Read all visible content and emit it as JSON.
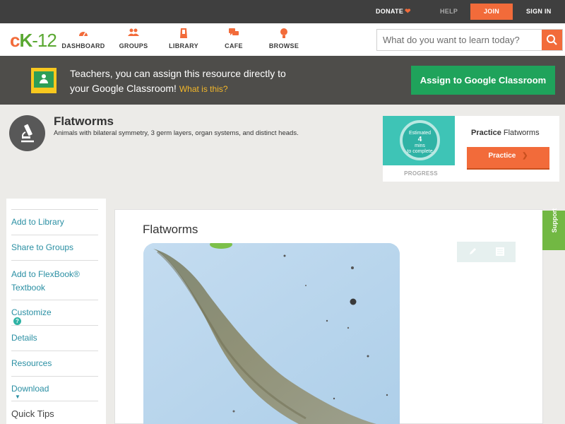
{
  "topbar": {
    "donate": "DONATE",
    "help": "HELP",
    "join": "JOIN",
    "signin": "SIGN IN"
  },
  "nav": {
    "logo": {
      "c": "c",
      "k": "K",
      "n": "-12"
    },
    "items": [
      {
        "label": "DASHBOARD",
        "icon": "dashboard-icon"
      },
      {
        "label": "GROUPS",
        "icon": "groups-icon"
      },
      {
        "label": "LIBRARY",
        "icon": "library-icon"
      },
      {
        "label": "CAFE",
        "icon": "cafe-icon"
      },
      {
        "label": "BROWSE",
        "icon": "browse-icon"
      }
    ],
    "search_placeholder": "What do you want to learn today?"
  },
  "banner": {
    "line1": "Teachers, you can assign this resource directly to",
    "line2": "your Google Classroom!",
    "what_is_this": "What is this?",
    "assign_button": "Assign to Google Classroom"
  },
  "concept": {
    "title": "Flatworms",
    "description": "Animals with bilateral symmetry, 3 germ layers, organ systems, and distinct heads."
  },
  "progress": {
    "ring_top": "Estimated",
    "ring_big": "4",
    "ring_unit": "mins",
    "ring_bottom": "to complete",
    "label": "PROGRESS",
    "practice_bold": "Practice",
    "practice_topic": "Flatworms",
    "practice_button": "Practice"
  },
  "sidebar": {
    "items": [
      "Add to Library",
      "Share to Groups",
      "Add to FlexBook®",
      "Textbook",
      "Customize",
      "Details",
      "Resources",
      "Download"
    ],
    "customize_help": "?",
    "quick_tips": "Quick Tips"
  },
  "content": {
    "title": "Flatworms",
    "support": "Support"
  },
  "colors": {
    "accent_orange": "#f26b3a",
    "brand_green": "#5aa832",
    "classroom_green": "#1fa35b",
    "link_teal": "#2a8fa3"
  }
}
